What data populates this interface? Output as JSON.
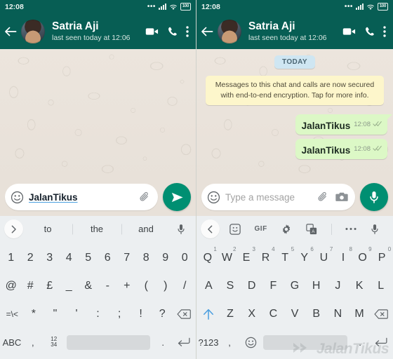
{
  "status_bar": {
    "time": "12:08",
    "battery": "100",
    "icons": [
      "more-dots",
      "signal",
      "wifi",
      "battery"
    ]
  },
  "app_bar": {
    "back_icon": "back-arrow-icon",
    "contact_name": "Satria Aji",
    "contact_status": "last seen today at 12:06",
    "video_icon": "video-call-icon",
    "call_icon": "phone-call-icon",
    "menu_icon": "overflow-menu-icon"
  },
  "chat": {
    "day_badge": "TODAY",
    "encryption_notice": "Messages to this chat and calls are now secured with end-to-end encryption. Tap for more info.",
    "messages": [
      {
        "text": "JalanTikus",
        "time": "12:08",
        "status": "read",
        "outgoing": true,
        "tail": true
      },
      {
        "text": "JalanTikus",
        "time": "12:08",
        "status": "read",
        "outgoing": true,
        "tail": false
      }
    ]
  },
  "composer_left": {
    "emoji_icon": "emoji-smiley-icon",
    "typed_text": "JalanTikus",
    "attach_icon": "paperclip-icon",
    "send_icon": "send-button"
  },
  "composer_right": {
    "emoji_icon": "emoji-smiley-icon",
    "placeholder": "Type a message",
    "attach_icon": "paperclip-icon",
    "camera_icon": "camera-icon",
    "mic_icon": "microphone-button"
  },
  "keyboard_left": {
    "strip": {
      "expand_icon": "chevron-right-icon",
      "suggestions": [
        "to",
        "the",
        "and"
      ],
      "mic_icon": "microphone-icon"
    },
    "rows": [
      [
        "1",
        "2",
        "3",
        "4",
        "5",
        "6",
        "7",
        "8",
        "9",
        "0"
      ],
      [
        "@",
        "#",
        "£",
        "_",
        "&",
        "-",
        "+",
        "(",
        ")",
        "/"
      ],
      [
        "=\\<",
        "*",
        "\"",
        "'",
        ":",
        ";",
        "!",
        "?",
        "backspace-icon"
      ]
    ],
    "bottom": {
      "mode_key": "ABC",
      "comma": ",",
      "numpad": "12 34",
      "space": "",
      "period": ".",
      "enter_icon": "enter-key-icon"
    }
  },
  "keyboard_right": {
    "strip": {
      "collapse_icon": "chevron-left-icon",
      "sticker_icon": "sticker-icon",
      "gif_label": "GIF",
      "settings_icon": "gear-icon",
      "translate_icon": "translate-icon",
      "more_icon": "more-dots-icon",
      "mic_icon": "microphone-icon"
    },
    "rows": [
      [
        {
          "k": "Q",
          "s": "1"
        },
        {
          "k": "W",
          "s": "2"
        },
        {
          "k": "E",
          "s": "3"
        },
        {
          "k": "R",
          "s": "4"
        },
        {
          "k": "T",
          "s": "5"
        },
        {
          "k": "Y",
          "s": "6"
        },
        {
          "k": "U",
          "s": "7"
        },
        {
          "k": "I",
          "s": "8"
        },
        {
          "k": "O",
          "s": "9"
        },
        {
          "k": "P",
          "s": "0"
        }
      ],
      [
        "A",
        "S",
        "D",
        "F",
        "G",
        "H",
        "J",
        "K",
        "L"
      ],
      [
        "shift-icon",
        "Z",
        "X",
        "C",
        "V",
        "B",
        "N",
        "M",
        "backspace-icon"
      ]
    ],
    "bottom": {
      "mode_key": "?123",
      "comma": ",",
      "emoji": "emoji-smiley-icon",
      "space": "",
      "period": ".",
      "enter_icon": "enter-key-icon"
    }
  },
  "watermark": {
    "text": "JalanTikus",
    "logo": "jalantikus-logo"
  },
  "colors": {
    "header_green": "#075e54",
    "accent_green": "#008f72",
    "bubble_out": "#dcf8c6",
    "chat_bg": "#e8e1d9",
    "day_badge": "#cfe6f2",
    "encryption_bg": "#fdf6cb",
    "shift_blue": "#4a9ee0"
  }
}
